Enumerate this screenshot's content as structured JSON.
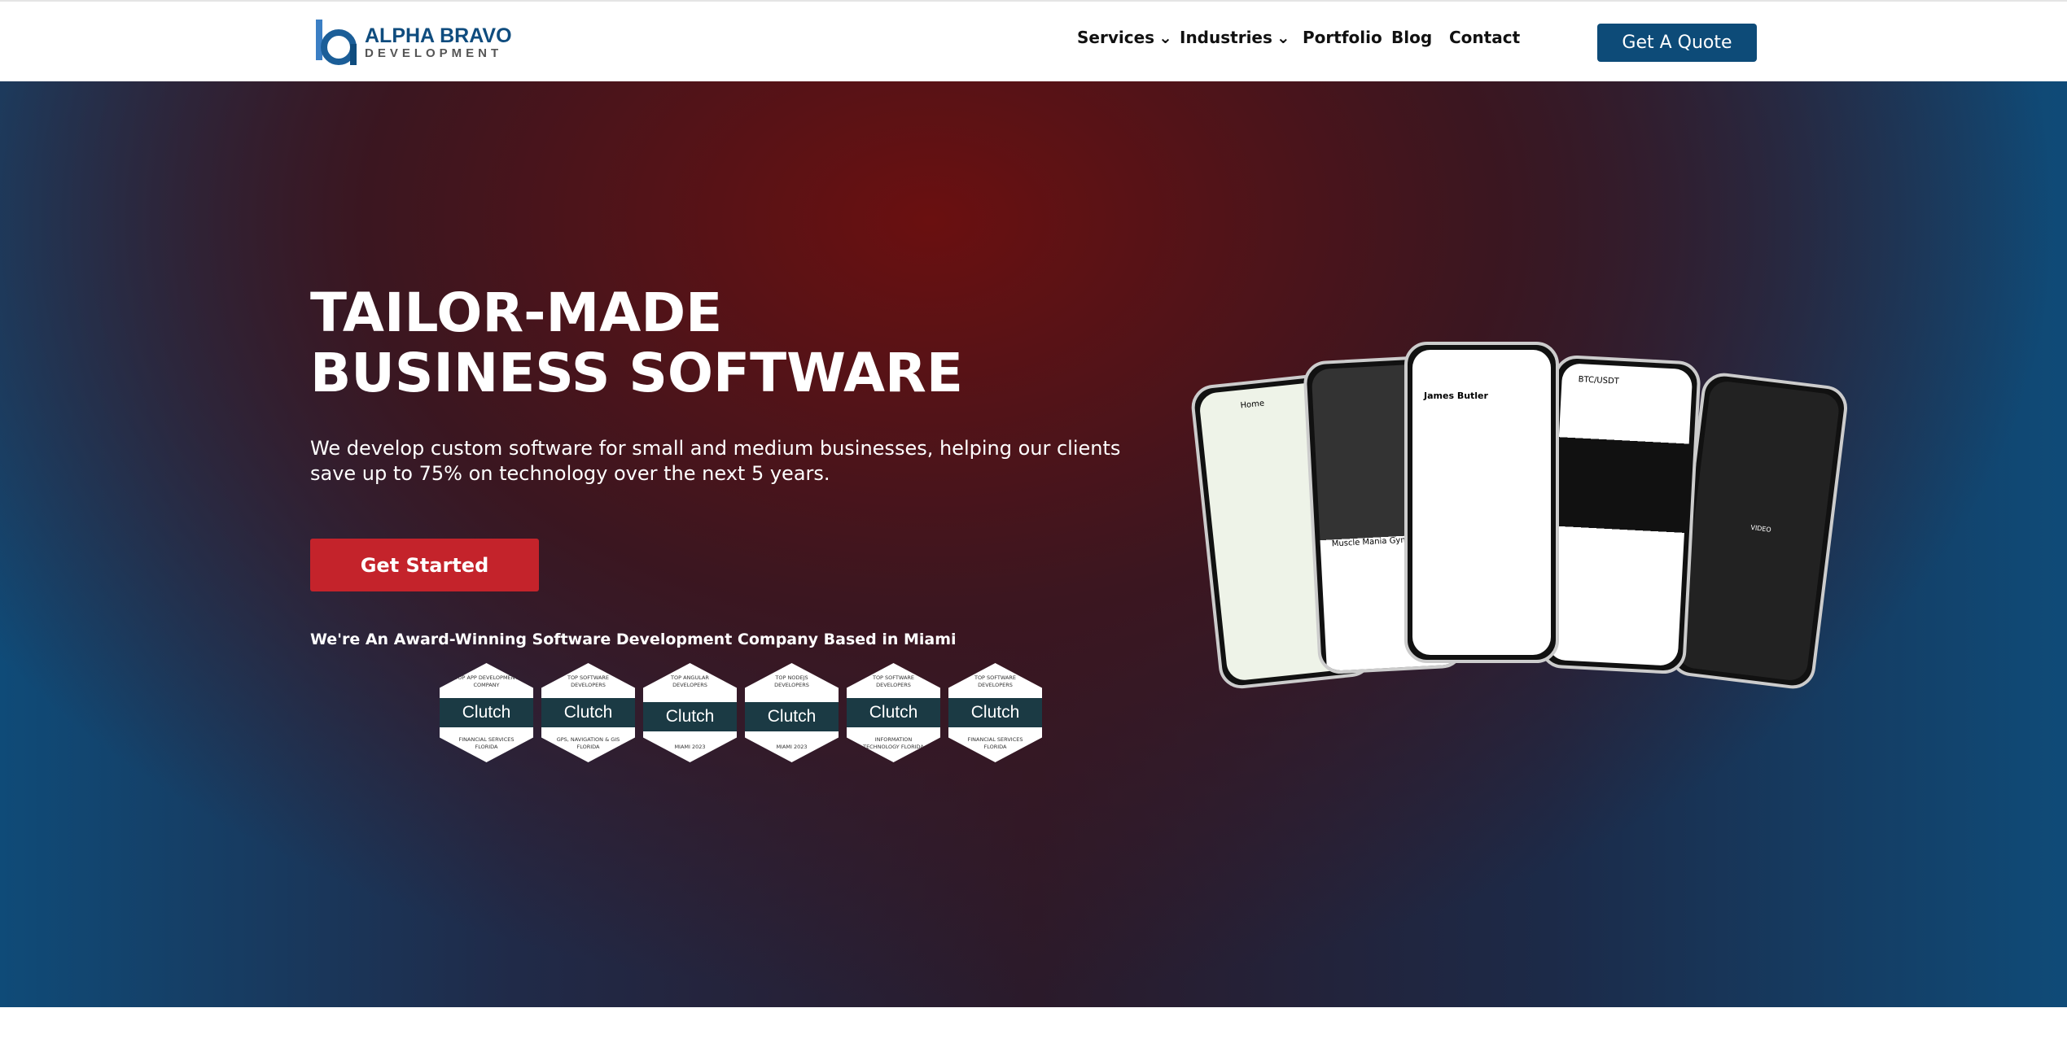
{
  "header": {
    "logo_line1": "ALPHA BRAVO",
    "logo_line2": "DEVELOPMENT",
    "menu": [
      {
        "label": "Services",
        "dropdown": true
      },
      {
        "label": "Industries",
        "dropdown": true
      },
      {
        "label": "Portfolio"
      },
      {
        "label": "Blog"
      },
      {
        "label": "Contact"
      }
    ],
    "cta": "Get A Quote"
  },
  "hero": {
    "title_line1": "TAILOR-MADE",
    "title_line2": "BUSINESS SOFTWARE",
    "subtitle": "We develop custom software for small and medium businesses, helping our clients save up to 75% on technology over the next 5 years.",
    "cta": "Get Started",
    "award_text": "We're An Award-Winning Software Development Company Based in Miami",
    "badges": [
      {
        "top": "TOP APP DEVELOPMENT COMPANY",
        "brand": "Clutch",
        "bottom": "FINANCIAL SERVICES FLORIDA"
      },
      {
        "top": "TOP SOFTWARE DEVELOPERS",
        "brand": "Clutch",
        "bottom": "GPS, NAVIGATION & GIS FLORIDA"
      },
      {
        "top": "TOP ANGULAR DEVELOPERS",
        "brand": "Clutch",
        "bottom": "MIAMI 2023"
      },
      {
        "top": "TOP NODEJS DEVELOPERS",
        "brand": "Clutch",
        "bottom": "MIAMI 2023"
      },
      {
        "top": "TOP SOFTWARE DEVELOPERS",
        "brand": "Clutch",
        "bottom": "INFORMATION TECHNOLOGY FLORIDA"
      },
      {
        "top": "TOP SOFTWARE DEVELOPERS",
        "brand": "Clutch",
        "bottom": "FINANCIAL SERVICES FLORIDA"
      }
    ],
    "phones": [
      {
        "label": "Home"
      },
      {
        "label": "Muscle Mania Gym"
      },
      {
        "label": "James Butler"
      },
      {
        "label": "BTC/USDT"
      },
      {
        "label": "VIDEO"
      }
    ]
  },
  "colors": {
    "brand": "#0d4b78",
    "accent": "#c4232b"
  }
}
